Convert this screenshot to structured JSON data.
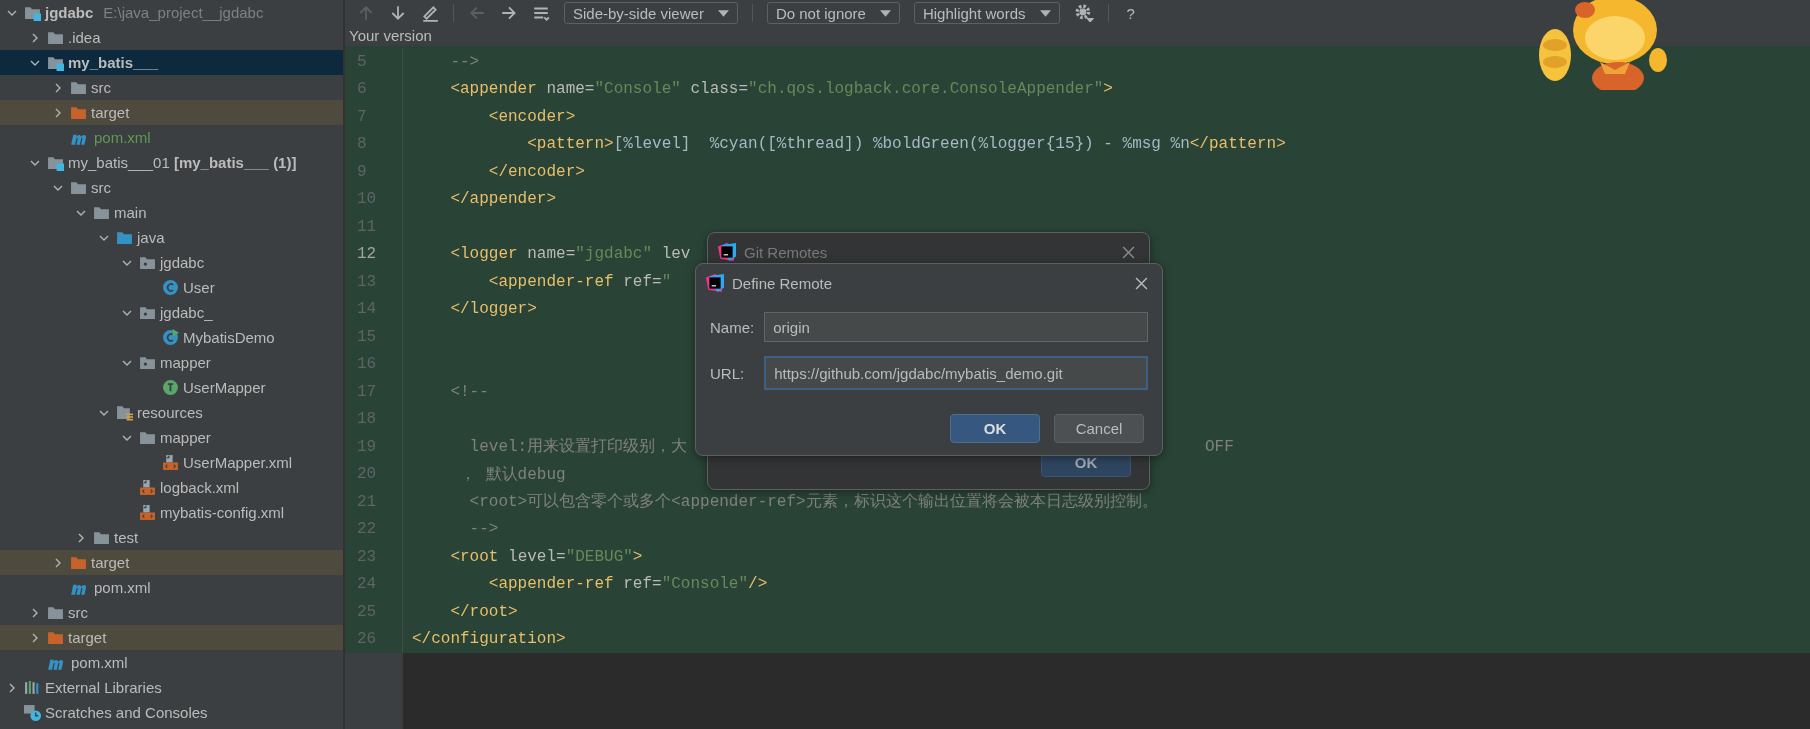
{
  "project_tree": [
    {
      "label": "jgdabc",
      "note": "E:\\java_project__jgdabc",
      "kind": "module",
      "bold": true,
      "expanded": true,
      "selected": false,
      "excluded": false,
      "children": [
        {
          "label": ".idea",
          "kind": "folder",
          "expanded": false,
          "selected": false,
          "excluded": false
        },
        {
          "label": "my_batis___",
          "kind": "module",
          "bold": true,
          "expanded": true,
          "selected": true,
          "excluded": false,
          "children": [
            {
              "label": "src",
              "kind": "folder",
              "expanded": false,
              "selected": false,
              "excluded": false
            },
            {
              "label": "target",
              "kind": "excluded-folder",
              "expanded": false,
              "selected": false,
              "excluded": true
            },
            {
              "label": "pom.xml",
              "kind": "maven",
              "color": "#629755",
              "selected": false,
              "excluded": false
            }
          ]
        },
        {
          "label": "my_batis___01 **[my_batis___ (1)]**",
          "kind": "module",
          "expanded": true,
          "selected": false,
          "excluded": false,
          "children": [
            {
              "label": "src",
              "kind": "folder",
              "expanded": true,
              "selected": false,
              "excluded": false,
              "children": [
                {
                  "label": "main",
                  "kind": "folder",
                  "expanded": true,
                  "selected": false,
                  "excluded": false,
                  "children": [
                    {
                      "label": "java",
                      "kind": "source-folder",
                      "expanded": true,
                      "selected": false,
                      "excluded": false,
                      "children": [
                        {
                          "label": "jgdabc",
                          "kind": "package",
                          "expanded": true,
                          "selected": false,
                          "excluded": false,
                          "children": [
                            {
                              "label": "User",
                              "kind": "class",
                              "selected": false,
                              "excluded": false
                            }
                          ]
                        },
                        {
                          "label": "jgdabc_",
                          "kind": "package",
                          "expanded": true,
                          "selected": false,
                          "excluded": false,
                          "children": [
                            {
                              "label": "MybatisDemo",
                              "kind": "runnable-class",
                              "selected": false,
                              "excluded": false
                            }
                          ]
                        },
                        {
                          "label": "mapper",
                          "kind": "package",
                          "expanded": true,
                          "selected": false,
                          "excluded": false,
                          "children": [
                            {
                              "label": "UserMapper",
                              "kind": "interface",
                              "selected": false,
                              "excluded": false
                            }
                          ]
                        }
                      ]
                    },
                    {
                      "label": "resources",
                      "kind": "resources-folder",
                      "expanded": true,
                      "selected": false,
                      "excluded": false,
                      "children": [
                        {
                          "label": "mapper",
                          "kind": "folder",
                          "expanded": true,
                          "selected": false,
                          "excluded": false,
                          "children": [
                            {
                              "label": "UserMapper.xml",
                              "kind": "xml",
                              "selected": false,
                              "excluded": false
                            }
                          ]
                        },
                        {
                          "label": "logback.xml",
                          "kind": "xml",
                          "selected": false,
                          "excluded": false
                        },
                        {
                          "label": "mybatis-config.xml",
                          "kind": "xml",
                          "selected": false,
                          "excluded": false
                        }
                      ]
                    }
                  ]
                },
                {
                  "label": "test",
                  "kind": "folder",
                  "expanded": false,
                  "selected": false,
                  "excluded": false
                }
              ]
            },
            {
              "label": "target",
              "kind": "excluded-folder",
              "expanded": false,
              "selected": false,
              "excluded": true
            },
            {
              "label": "pom.xml",
              "kind": "maven",
              "selected": false,
              "excluded": false
            }
          ]
        },
        {
          "label": "src",
          "kind": "folder",
          "expanded": false,
          "selected": false,
          "excluded": false
        },
        {
          "label": "target",
          "kind": "excluded-folder",
          "expanded": false,
          "selected": false,
          "excluded": true
        },
        {
          "label": "pom.xml",
          "kind": "maven",
          "selected": false,
          "excluded": false
        }
      ]
    },
    {
      "label": "External Libraries",
      "kind": "libraries",
      "expanded": false,
      "selected": false,
      "excluded": false
    },
    {
      "label": "Scratches and Consoles",
      "kind": "scratches",
      "selected": false,
      "excluded": false
    }
  ],
  "toolbar": {
    "actions": [
      {
        "kind": "up",
        "disabled": true
      },
      {
        "kind": "down",
        "disabled": false
      },
      {
        "kind": "edit",
        "disabled": false
      },
      {
        "kind": "back",
        "disabled": true
      },
      {
        "kind": "forward",
        "disabled": false
      },
      {
        "kind": "list",
        "disabled": false
      }
    ],
    "dropdowns": [
      "Side-by-side viewer",
      "Do not ignore",
      "Highlight words"
    ],
    "help": "?"
  },
  "editor": {
    "title": "Your version",
    "lines": [
      {
        "n": "5",
        "current": false,
        "tokens": [
          {
            "kind": "comment",
            "t": "    -->"
          }
        ]
      },
      {
        "n": "6",
        "current": false,
        "tokens": [
          {
            "kind": "tag",
            "t": "    <appender"
          },
          {
            "kind": "attr",
            "t": " name="
          },
          {
            "kind": "value",
            "t": "\"Console\""
          },
          {
            "kind": "attr",
            "t": " class="
          },
          {
            "kind": "value",
            "t": "\"ch.qos.logback.core.ConsoleAppender\""
          },
          {
            "kind": "tag",
            "t": ">"
          }
        ]
      },
      {
        "n": "7",
        "current": false,
        "tokens": [
          {
            "kind": "tag",
            "t": "        <encoder>"
          }
        ]
      },
      {
        "n": "8",
        "current": false,
        "tokens": [
          {
            "kind": "tag",
            "t": "            <pattern>"
          },
          {
            "kind": "text",
            "t": "[%level]  %cyan([%thread]) %boldGreen(%logger{15}) - %msg %n"
          },
          {
            "kind": "tag",
            "t": "</pattern>"
          }
        ]
      },
      {
        "n": "9",
        "current": false,
        "tokens": [
          {
            "kind": "tag",
            "t": "        </encoder>"
          }
        ]
      },
      {
        "n": "10",
        "current": false,
        "tokens": [
          {
            "kind": "tag",
            "t": "    </appender>"
          }
        ]
      },
      {
        "n": "11",
        "current": false
      },
      {
        "n": "12",
        "current": true,
        "tokens": [
          {
            "kind": "tag",
            "t": "    <logger"
          },
          {
            "kind": "attr",
            "t": " name="
          },
          {
            "kind": "value",
            "t": "\"jgdabc\""
          },
          {
            "kind": "attr",
            "t": " lev"
          }
        ]
      },
      {
        "n": "13",
        "current": false,
        "tokens": [
          {
            "kind": "tag",
            "t": "        <appender-ref"
          },
          {
            "kind": "attr",
            "t": " ref="
          },
          {
            "kind": "value",
            "t": "\""
          }
        ]
      },
      {
        "n": "14",
        "current": false,
        "tokens": [
          {
            "kind": "tag",
            "t": "    </logger>"
          }
        ]
      },
      {
        "n": "15",
        "current": false
      },
      {
        "n": "16",
        "current": false
      },
      {
        "n": "17",
        "current": false,
        "tokens": [
          {
            "kind": "comment",
            "t": "    <!--"
          }
        ]
      },
      {
        "n": "18",
        "current": false
      },
      {
        "n": "19",
        "current": false,
        "tokens": [
          {
            "kind": "comment",
            "t": "      level:用来设置打印级别，大"
          }
        ],
        "tail": "OFF"
      },
      {
        "n": "20",
        "current": false,
        "tokens": [
          {
            "kind": "comment",
            "t": "     ， 默认debug"
          }
        ]
      },
      {
        "n": "21",
        "current": false,
        "tokens": [
          {
            "kind": "comment",
            "t": "      <root>可以包含零个或多个<appender-ref>元素，标识这个输出位置将会被本日志级别控制。"
          }
        ]
      },
      {
        "n": "22",
        "current": false,
        "tokens": [
          {
            "kind": "comment",
            "t": "      -->"
          }
        ]
      },
      {
        "n": "23",
        "current": false,
        "tokens": [
          {
            "kind": "tag",
            "t": "    <root"
          },
          {
            "kind": "attr",
            "t": " level="
          },
          {
            "kind": "value",
            "t": "\"DEBUG\""
          },
          {
            "kind": "tag",
            "t": ">"
          }
        ]
      },
      {
        "n": "24",
        "current": false,
        "tokens": [
          {
            "kind": "tag",
            "t": "        <appender-ref"
          },
          {
            "kind": "attr",
            "t": " ref="
          },
          {
            "kind": "value",
            "t": "\"Console\""
          },
          {
            "kind": "tag",
            "t": "/>"
          }
        ]
      },
      {
        "n": "25",
        "current": false,
        "tokens": [
          {
            "kind": "tag",
            "t": "    </root>"
          }
        ]
      },
      {
        "n": "26",
        "current": false,
        "tokens": [
          {
            "kind": "tag",
            "t": "</configuration>"
          }
        ]
      }
    ]
  },
  "git_remotes_dialog": {
    "title": "Git Remotes",
    "active": false,
    "ok": "OK"
  },
  "define_remote_dialog": {
    "title": "Define Remote",
    "active": true,
    "fields": [
      {
        "label": "Name:",
        "value": "origin",
        "focused": false
      },
      {
        "label": "URL:",
        "value": "https://github.com/jgdabc/mybatis_demo.git",
        "focused": true
      }
    ],
    "ok": "OK",
    "cancel": "Cancel"
  }
}
